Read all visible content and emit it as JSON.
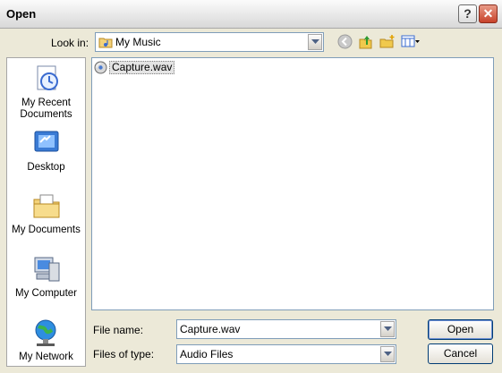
{
  "window": {
    "title": "Open",
    "help_glyph": "?",
    "close_glyph": "✕"
  },
  "look_in": {
    "label": "Look in:",
    "value": "My Music"
  },
  "toolbar": [
    "back-icon",
    "up-folder-icon",
    "new-folder-icon",
    "view-menu-icon"
  ],
  "places": [
    {
      "label_line1": "My Recent",
      "label_line2": "Documents",
      "icon": "my-recent-documents-icon"
    },
    {
      "label_line1": "Desktop",
      "icon": "desktop-icon"
    },
    {
      "label_line1": "My Documents",
      "icon": "my-documents-icon"
    },
    {
      "label_line1": "My Computer",
      "icon": "my-computer-icon"
    },
    {
      "label_line1": "My Network",
      "icon": "my-network-icon"
    }
  ],
  "files": [
    {
      "name": "Capture.wav",
      "icon": "audio-file-icon"
    }
  ],
  "file_name": {
    "label": "File name:",
    "value": "Capture.wav"
  },
  "file_type": {
    "label": "Files of type:",
    "value": "Audio Files"
  },
  "buttons": {
    "open": "Open",
    "cancel": "Cancel"
  },
  "colors": {
    "dialog_bg": "#ece9d8",
    "field_border": "#7f9db9",
    "button_border": "#003c74"
  }
}
